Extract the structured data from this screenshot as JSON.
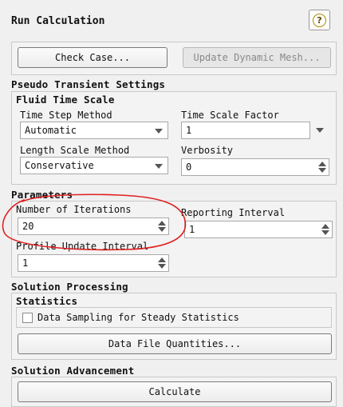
{
  "header": {
    "title": "Run Calculation",
    "help_icon": "help-icon"
  },
  "buttons": {
    "check_case": "Check Case...",
    "update_mesh": "Update Dynamic Mesh..."
  },
  "pseudo": {
    "title": "Pseudo Transient Settings",
    "fluid_title": "Fluid Time Scale",
    "time_step_method_label": "Time Step Method",
    "time_step_method_value": "Automatic",
    "time_scale_factor_label": "Time Scale Factor",
    "time_scale_factor_value": "1",
    "length_scale_method_label": "Length Scale Method",
    "length_scale_method_value": "Conservative",
    "verbosity_label": "Verbosity",
    "verbosity_value": "0"
  },
  "parameters": {
    "title": "Parameters",
    "iterations_label": "Number of Iterations",
    "iterations_value": "20",
    "reporting_label": "Reporting Interval",
    "reporting_value": "1",
    "profile_label": "Profile Update Interval",
    "profile_value": "1"
  },
  "processing": {
    "title": "Solution Processing",
    "statistics_title": "Statistics",
    "sampling_label": "Data Sampling for Steady Statistics",
    "sampling_checked": false,
    "data_file_button": "Data File Quantities..."
  },
  "advancement": {
    "title": "Solution Advancement",
    "calculate_button": "Calculate"
  },
  "annotation": {
    "color": "#e02020"
  }
}
